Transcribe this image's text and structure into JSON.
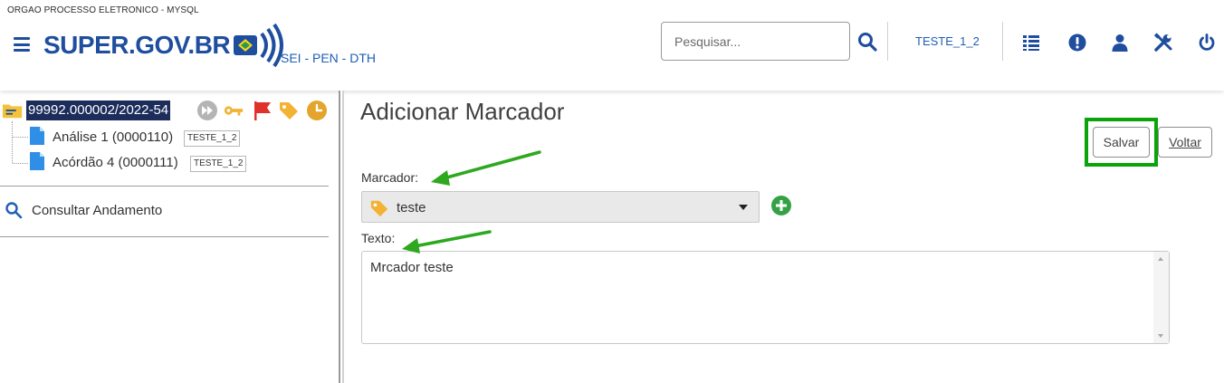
{
  "header": {
    "org_label": "ORGAO PROCESSO ELETRONICO - MYSQL",
    "logo_text": "SUPER.GOV.BR",
    "unit_label": "SEI - PEN - DTH",
    "search_placeholder": "Pesquisar...",
    "user_unit": "TESTE_1_2",
    "icons": [
      "menu-icon",
      "search-icon",
      "control-panel-icon",
      "notice-icon",
      "user-icon",
      "tools-icon",
      "power-icon"
    ]
  },
  "tree": {
    "process_number": "99992.000002/2022-54",
    "process_icons": [
      "folder-icon",
      "forward-icon",
      "key-icon",
      "flag-icon",
      "tag-icon",
      "clock-icon"
    ],
    "documents": [
      {
        "label": "Análise 1 (0000110)",
        "tag": "TESTE_1_2"
      },
      {
        "label": "Acórdão 4 (0000111)",
        "tag": "TESTE_1_2"
      }
    ],
    "consult_label": "Consultar Andamento"
  },
  "form": {
    "title": "Adicionar Marcador",
    "save_label": "Salvar",
    "back_label": "Voltar",
    "marker_label": "Marcador:",
    "marker_value": "teste",
    "text_label": "Texto:",
    "text_value": "Mrcador teste"
  },
  "colors": {
    "brand_blue": "#1f4e9e",
    "link_blue": "#1f5fb5",
    "selection_navy": "#1c2c5b",
    "highlight_green": "#0aa40a",
    "tag_orange": "#f2b233",
    "flag_red": "#e0322d"
  }
}
